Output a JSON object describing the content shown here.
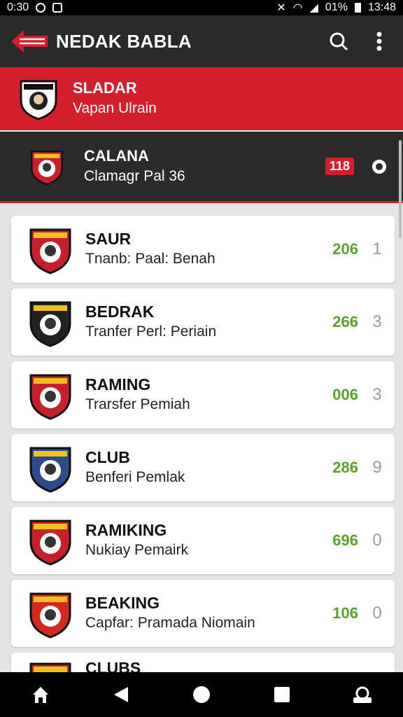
{
  "status_bar": {
    "time_left": "0:30",
    "battery_text": "01%",
    "time_right": "13:48"
  },
  "app_bar": {
    "title": "NEDAK BABLA",
    "search_icon": "search-icon",
    "menu_icon": "more-vert-icon"
  },
  "featured_row": {
    "title": "SLADAR",
    "subtitle": "Vapan Ulrain"
  },
  "selected_row": {
    "title": "CALANA",
    "subtitle": "Clamagr Pal 36",
    "badge": "118"
  },
  "teams": [
    {
      "name": "SAUR",
      "detail": "Tnanb: Paal: Benah",
      "score": "206",
      "rank": "1",
      "badge_color": "#c8202b"
    },
    {
      "name": "BEDRAK",
      "detail": "Tranfer Perl: Periain",
      "score": "266",
      "rank": "3",
      "badge_color": "#222222"
    },
    {
      "name": "RAMING",
      "detail": "Trarsfer Pemiah",
      "score": "006",
      "rank": "3",
      "badge_color": "#c8202b"
    },
    {
      "name": "CLUB",
      "detail": "Benferi Pemlak",
      "score": "286",
      "rank": "9",
      "badge_color": "#2d4a8a"
    },
    {
      "name": "RAMIKING",
      "detail": "Nukiay Pemairk",
      "score": "696",
      "rank": "0",
      "badge_color": "#c8202b"
    },
    {
      "name": "BEAKING",
      "detail": "Capfar: Pramada Niomain",
      "score": "106",
      "rank": "0",
      "badge_color": "#d42a1e"
    },
    {
      "name": "CLUBS",
      "detail": "",
      "score": "",
      "rank": "",
      "badge_color": "#c8202b"
    }
  ],
  "colors": {
    "accent": "#d21f2b",
    "score_green": "#5aa32a",
    "dark": "#2b2b2b"
  },
  "nav_bar": {
    "icons": [
      "home-icon",
      "back-icon",
      "home-circle-icon",
      "recents-icon",
      "assistant-icon"
    ]
  }
}
